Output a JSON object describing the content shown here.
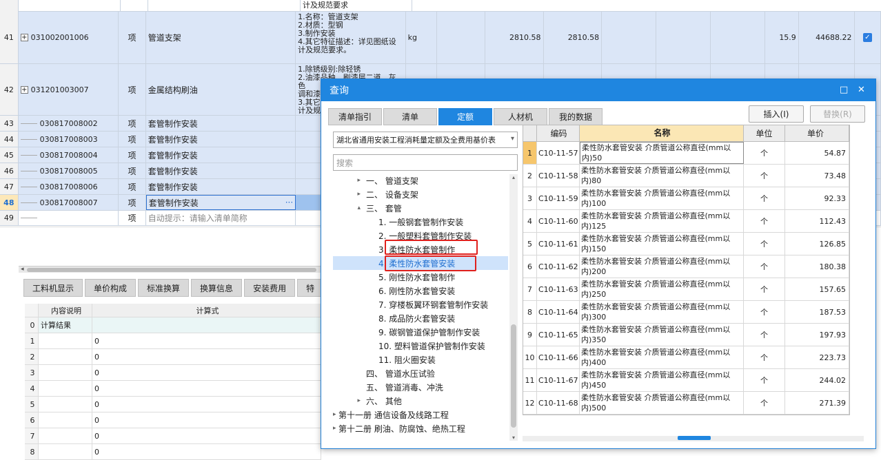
{
  "main_grid": {
    "top_partial_text": "计及规范要求",
    "rows": [
      {
        "idx": "41",
        "code": "031002001006",
        "unit": "项",
        "name": "管道支架",
        "feature": "1.名称：管道支架\n2.材质：型钢\n3.制作安装\n4.其它特征描述：详见图纸设计及规范要求。",
        "unit2": "kg",
        "q1": "2810.58",
        "q2": "2810.58",
        "price": "15.9",
        "total": "44688.22",
        "checked": "✓"
      },
      {
        "idx": "42",
        "code": "031201003007",
        "unit": "项",
        "name": "金属结构刷油",
        "feature": "1.除锈级别:除轻锈\n2.油漆品种、刷漆层二道、灰色\n调和漆\n3.其它\n计及规"
      },
      {
        "idx": "43",
        "code": "030817008002",
        "unit": "项",
        "name": "套管制作安装"
      },
      {
        "idx": "44",
        "code": "030817008003",
        "unit": "项",
        "name": "套管制作安装"
      },
      {
        "idx": "45",
        "code": "030817008004",
        "unit": "项",
        "name": "套管制作安装"
      },
      {
        "idx": "46",
        "code": "030817008005",
        "unit": "项",
        "name": "套管制作安装"
      },
      {
        "idx": "47",
        "code": "030817008006",
        "unit": "项",
        "name": "套管制作安装"
      },
      {
        "idx": "48",
        "code": "030817008007",
        "unit": "项",
        "name": "套管制作安装",
        "dots": "···"
      },
      {
        "idx": "49",
        "code": "",
        "unit": "项",
        "name": "自动提示：请输入清单简称"
      }
    ]
  },
  "bottom_tabs": [
    "工料机显示",
    "单价构成",
    "标准换算",
    "换算信息",
    "安装费用",
    "特"
  ],
  "lower_table": {
    "headers": [
      "内容说明",
      "计算式"
    ],
    "rows": [
      {
        "a": "0",
        "b": "计算结果",
        "d": ""
      },
      {
        "a": "1",
        "b": "",
        "d": "0"
      },
      {
        "a": "2",
        "b": "",
        "d": "0"
      },
      {
        "a": "3",
        "b": "",
        "d": "0"
      },
      {
        "a": "4",
        "b": "",
        "d": "0"
      },
      {
        "a": "5",
        "b": "",
        "d": "0"
      },
      {
        "a": "6",
        "b": "",
        "d": "0"
      },
      {
        "a": "7",
        "b": "",
        "d": "0"
      },
      {
        "a": "8",
        "b": "",
        "d": "0"
      }
    ]
  },
  "dialog": {
    "title": "查询",
    "max_icon": "□",
    "close_icon": "✕",
    "tabs": [
      "清单指引",
      "清单",
      "定额",
      "人材机",
      "我的数据"
    ],
    "insert_label": "插入(I)",
    "replace_label": "替换(R)",
    "library": "湖北省通用安装工程消耗量定额及全费用基价表",
    "search_placeholder": "搜索",
    "tree": [
      {
        "label": "一、 管道支架",
        "arrow": "▸"
      },
      {
        "label": "二、 设备支架",
        "arrow": "▸"
      },
      {
        "label": "三、 套管",
        "arrow": "▴"
      },
      {
        "label": "1. 一般钢套管制作安装",
        "arrow": ""
      },
      {
        "label": "2. 一般塑料套管制作安装",
        "arrow": ""
      },
      {
        "label": "3. 柔性防水套管制作",
        "arrow": ""
      },
      {
        "label": "4. 柔性防水套管安装",
        "arrow": ""
      },
      {
        "label": "5. 刚性防水套管制作",
        "arrow": ""
      },
      {
        "label": "6. 刚性防水套管安装",
        "arrow": ""
      },
      {
        "label": "7. 穿楼板翼环钢套管制作安装",
        "arrow": ""
      },
      {
        "label": "8. 成品防火套管安装",
        "arrow": ""
      },
      {
        "label": "9. 碳钢管道保护管制作安装",
        "arrow": ""
      },
      {
        "label": "10. 塑料管道保护管制作安装",
        "arrow": ""
      },
      {
        "label": "11. 阻火圈安装",
        "arrow": ""
      },
      {
        "label": "四、 管道水压试验",
        "arrow": ""
      },
      {
        "label": "五、 管道消毒、冲洗",
        "arrow": ""
      },
      {
        "label": "六、 其他",
        "arrow": "▸"
      },
      {
        "label": "第十一册 通信设备及线路工程",
        "arrow": "▸"
      },
      {
        "label": "第十二册 刷油、防腐蚀、绝热工程",
        "arrow": "▸"
      }
    ],
    "table_headers": [
      "编码",
      "名称",
      "单位",
      "单价"
    ],
    "rows": [
      {
        "no": "1",
        "code": "C10-11-57",
        "name": "柔性防水套管安装 介质管道公称直径(mm以内)50",
        "unit": "个",
        "price": "54.87"
      },
      {
        "no": "2",
        "code": "C10-11-58",
        "name": "柔性防水套管安装 介质管道公称直径(mm以内)80",
        "unit": "个",
        "price": "73.48"
      },
      {
        "no": "3",
        "code": "C10-11-59",
        "name": "柔性防水套管安装 介质管道公称直径(mm以内)100",
        "unit": "个",
        "price": "92.33"
      },
      {
        "no": "4",
        "code": "C10-11-60",
        "name": "柔性防水套管安装 介质管道公称直径(mm以内)125",
        "unit": "个",
        "price": "112.43"
      },
      {
        "no": "5",
        "code": "C10-11-61",
        "name": "柔性防水套管安装 介质管道公称直径(mm以内)150",
        "unit": "个",
        "price": "126.85"
      },
      {
        "no": "6",
        "code": "C10-11-62",
        "name": "柔性防水套管安装 介质管道公称直径(mm以内)200",
        "unit": "个",
        "price": "180.38"
      },
      {
        "no": "7",
        "code": "C10-11-63",
        "name": "柔性防水套管安装 介质管道公称直径(mm以内)250",
        "unit": "个",
        "price": "157.65"
      },
      {
        "no": "8",
        "code": "C10-11-64",
        "name": "柔性防水套管安装 介质管道公称直径(mm以内)300",
        "unit": "个",
        "price": "187.53"
      },
      {
        "no": "9",
        "code": "C10-11-65",
        "name": "柔性防水套管安装 介质管道公称直径(mm以内)350",
        "unit": "个",
        "price": "197.93"
      },
      {
        "no": "10",
        "code": "C10-11-66",
        "name": "柔性防水套管安装 介质管道公称直径(mm以内)400",
        "unit": "个",
        "price": "223.73"
      },
      {
        "no": "11",
        "code": "C10-11-67",
        "name": "柔性防水套管安装 介质管道公称直径(mm以内)450",
        "unit": "个",
        "price": "244.02"
      },
      {
        "no": "12",
        "code": "C10-11-68",
        "name": "柔性防水套管安装 介质管道公称直径(mm以内)500",
        "unit": "个",
        "price": "271.39"
      }
    ]
  },
  "colors": {
    "accent": "#1f86e0",
    "highlight_box": "#e0201c",
    "selected_row": "#dbe6f7"
  }
}
